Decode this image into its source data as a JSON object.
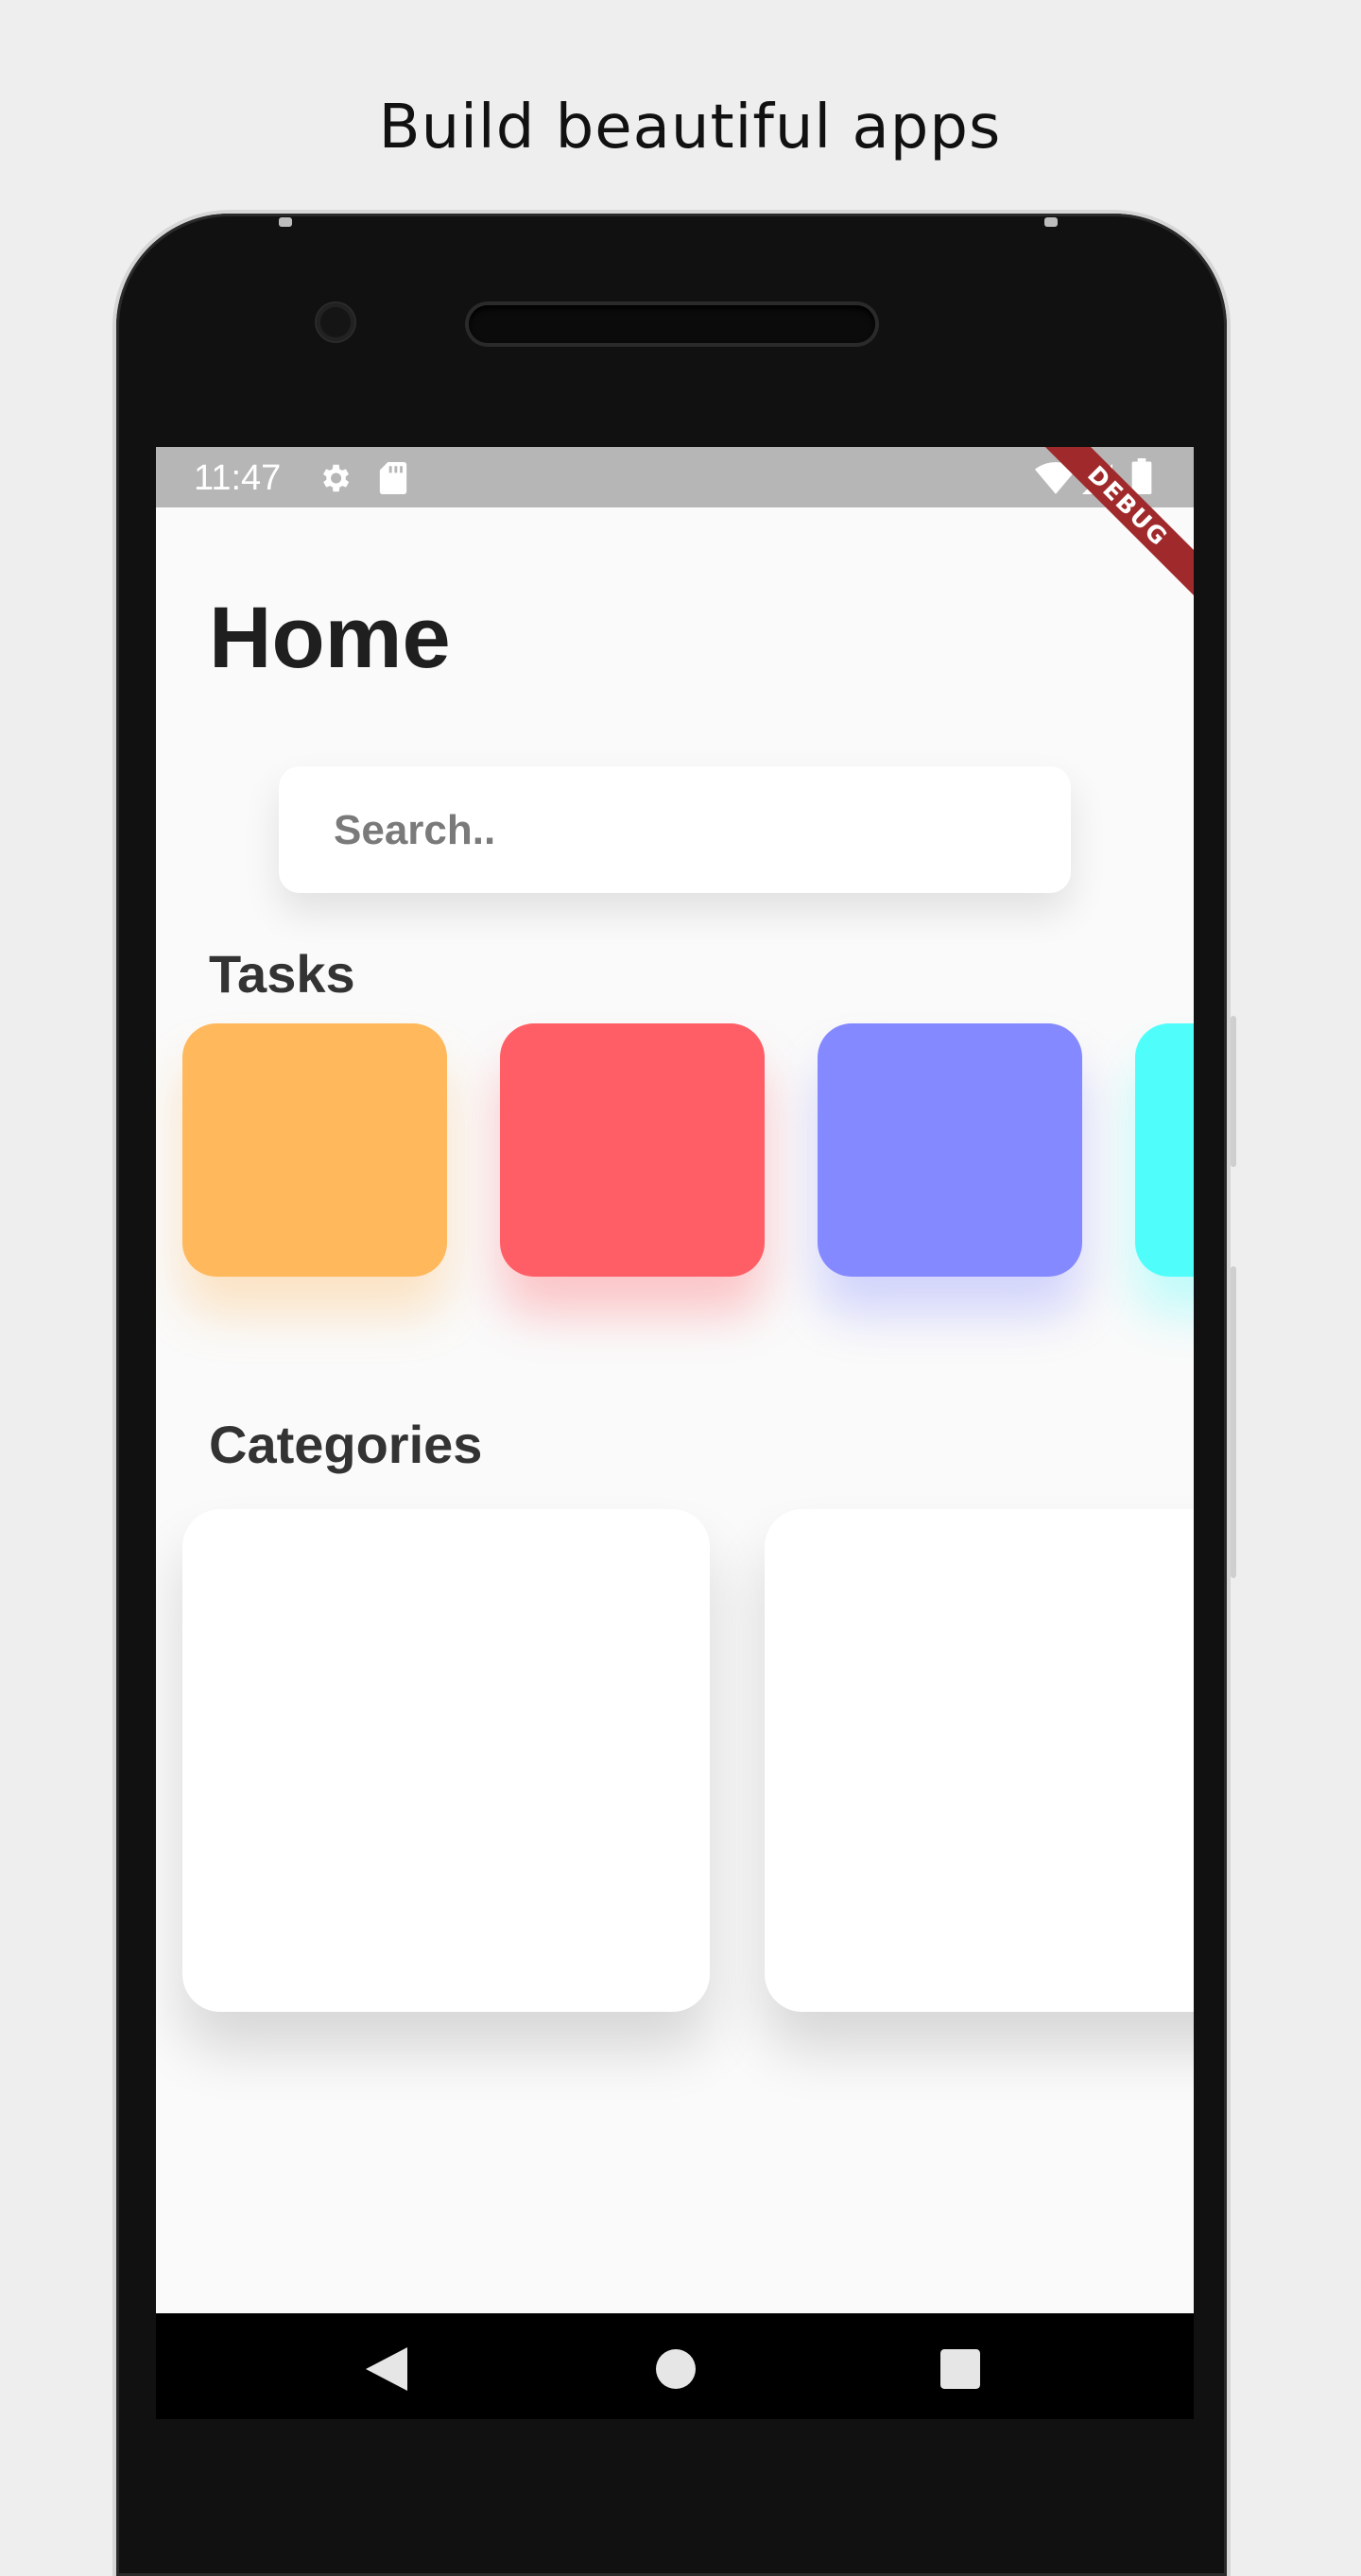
{
  "headline": "Build beautiful apps",
  "status_bar": {
    "time": "11:47",
    "debug_banner": "DEBUG"
  },
  "home": {
    "title": "Home",
    "search": {
      "placeholder": "Search.."
    },
    "tasks": {
      "title": "Tasks",
      "cards": [
        {
          "color": "#ffb85c"
        },
        {
          "color": "#ff5e66"
        },
        {
          "color": "#8589ff"
        },
        {
          "color": "#4ffefb"
        }
      ]
    },
    "categories": {
      "title": "Categories",
      "cards": [
        {},
        {}
      ]
    }
  },
  "nav": {
    "icons": [
      "back-icon",
      "home-icon",
      "recents-icon"
    ]
  }
}
